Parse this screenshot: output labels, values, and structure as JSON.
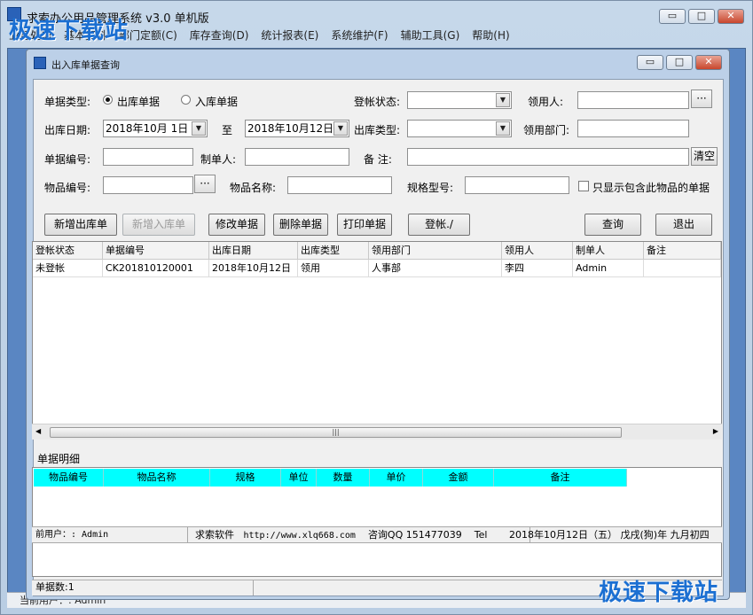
{
  "main": {
    "title": "求索办公用品管理系统 v3.0 单机版",
    "menu": [
      "业务处理",
      "基本资料",
      "部门定额(C)",
      "库存查询(D)",
      "统计报表(E)",
      "系统维护(F)",
      "辅助工具(G)",
      "帮助(H)"
    ],
    "status_text": "当前用户：: Admin",
    "controls": {
      "minimize": "▭",
      "maximize": "□",
      "close": "✕"
    }
  },
  "watermark": {
    "top": "极速下载站",
    "bottom": "极速下载站"
  },
  "dialog": {
    "title": "出入库单据查询",
    "controls": {
      "minimize": "▭",
      "maximize": "□",
      "close": "✕"
    }
  },
  "form": {
    "doc_type_label": "单据类型:",
    "doc_type_out": "出库单据",
    "doc_type_in": "入库单据",
    "post_status_label": "登帐状态:",
    "post_status_value": "",
    "recipient_label": "领用人:",
    "recipient_value": "",
    "browse_btn": "···",
    "out_date_label": "出库日期:",
    "date_from": "2018年10月 1日",
    "to_label": "至",
    "date_to": "2018年10月12日",
    "out_type_label": "出库类型:",
    "out_type_value": "",
    "dept_label": "领用部门:",
    "dept_value": "",
    "doc_no_label": "单据编号:",
    "doc_no_value": "",
    "maker_label": "制单人:",
    "maker_value": "",
    "note_label": "备  注:",
    "note_value": "",
    "clear_btn": "清空",
    "item_no_label": "物品编号:",
    "item_no_value": "",
    "item_name_label": "物品名称:",
    "item_name_value": "",
    "spec_label": "规格型号:",
    "spec_value": "",
    "only_show_label": "只显示包含此物品的单据"
  },
  "buttons": {
    "new_out": "新增出库单",
    "new_in": "新增入库单",
    "edit": "修改单据",
    "delete": "删除单据",
    "print": "打印单据",
    "post": "登帐./",
    "query": "查询",
    "exit": "退出"
  },
  "grid": {
    "columns": [
      "登帐状态",
      "单据编号",
      "出库日期",
      "出库类型",
      "领用部门",
      "领用人",
      "制单人",
      "备注"
    ],
    "rows": [
      [
        "未登帐",
        "CK201810120001",
        "2018年10月12日",
        "领用",
        "人事部",
        "李四",
        "Admin",
        ""
      ]
    ]
  },
  "detail": {
    "title": "单据明细",
    "columns": [
      "物品编号",
      "物品名称",
      "规格",
      "单位",
      "数量",
      "单价",
      "金额",
      "备注"
    ]
  },
  "info_bar": {
    "user": "前用户：: Admin",
    "company": "求索软件",
    "url": "http://www.xlq668.com",
    "qq": "咨询QQ 151477039",
    "tel": "Tel",
    "date": "2018年10月12日（五） 戊戌(狗)年 九月初四"
  },
  "count_bar": {
    "text": "单据数:1"
  }
}
